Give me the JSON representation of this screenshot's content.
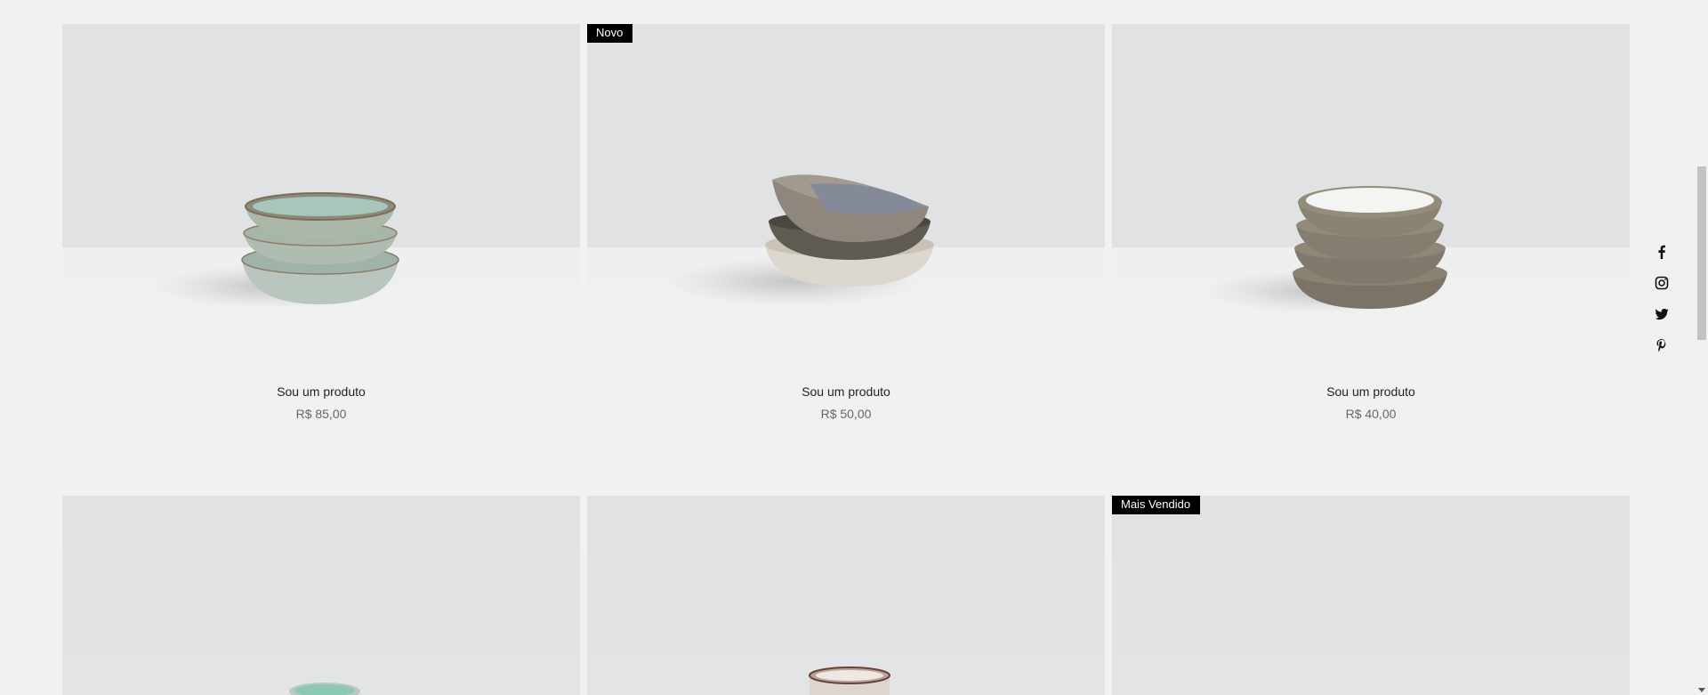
{
  "products": [
    {
      "title": "Sou um produto",
      "price": "R$ 85,00",
      "badge": ""
    },
    {
      "title": "Sou um produto",
      "price": "R$ 50,00",
      "badge": "Novo"
    },
    {
      "title": "Sou um produto",
      "price": "R$ 40,00",
      "badge": ""
    },
    {
      "title": "",
      "price": "",
      "badge": ""
    },
    {
      "title": "",
      "price": "",
      "badge": ""
    },
    {
      "title": "",
      "price": "",
      "badge": "Mais Vendido"
    }
  ],
  "social": {
    "icons": [
      "facebook-icon",
      "instagram-icon",
      "twitter-icon",
      "pinterest-icon"
    ]
  },
  "colors": {
    "background": "#f1f1f0",
    "badge_bg": "#000000",
    "badge_text": "#ffffff",
    "image_bg": "#e1e2e4"
  }
}
